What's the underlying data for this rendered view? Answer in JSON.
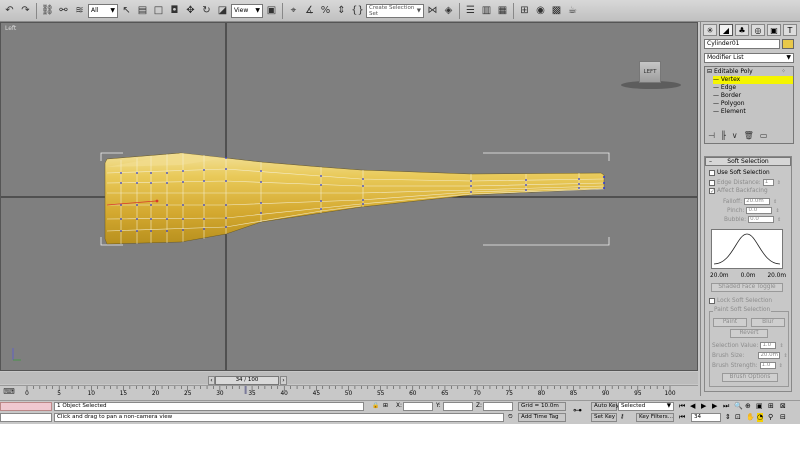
{
  "toolbar": {
    "selection_filter": "All",
    "ref_coord": "View",
    "named_selection": "Create Selection Set",
    "icons": [
      "undo-icon",
      "redo-icon",
      "select-link-icon",
      "unlink-icon",
      "bind-space-warp-icon",
      "selection-filter-icon",
      "select-object-icon",
      "select-by-name-icon",
      "rect-region-icon",
      "window-crossing-icon",
      "move-icon",
      "rotate-icon",
      "scale-icon",
      "pivot-icon",
      "snap-icon",
      "angle-snap-icon",
      "percent-snap-icon",
      "spinner-snap-icon",
      "edit-named-sets-icon",
      "mirror-icon",
      "align-icon",
      "layer-manager-icon",
      "graphite-ribbon-icon",
      "curve-editor-icon",
      "schematic-view-icon",
      "material-editor-icon",
      "render-setup-icon",
      "render-frame-icon",
      "render-icon"
    ]
  },
  "viewport": {
    "label": "Left",
    "viewcube_label": "LEFT"
  },
  "command_panel": {
    "object_name": "Cylinder01",
    "object_color": "#e8c84a",
    "modifier_list": "Modifier List",
    "stack": {
      "root": "Editable Poly",
      "items": [
        "Vertex",
        "Edge",
        "Border",
        "Polygon",
        "Element"
      ],
      "selected": "Vertex"
    },
    "soft_selection": {
      "title": "Soft Selection",
      "use_soft_selection": "Use Soft Selection",
      "edge_distance": "Edge Distance:",
      "edge_distance_value": "1",
      "affect_backfacing": "Affect Backfacing",
      "falloff_label": "Falloff:",
      "falloff_value": "20.0m",
      "pinch_label": "Pinch:",
      "pinch_value": "0.0",
      "bubble_label": "Bubble:",
      "bubble_value": "0.0",
      "curve_left": "20.0m",
      "curve_mid": "0.0m",
      "curve_right": "20.0m",
      "shaded_face_toggle": "Shaded Face Toggle",
      "lock_soft_selection": "Lock Soft Selection",
      "paint_group": "Paint Soft Selection",
      "paint": "Paint",
      "blur": "Blur",
      "revert": "Revert",
      "selection_value_label": "Selection Value:",
      "selection_value": "1.0",
      "brush_size_label": "Brush Size:",
      "brush_size": "20.0m",
      "brush_strength_label": "Brush Strength:",
      "brush_strength": "1.0",
      "brush_options": "Brush Options"
    }
  },
  "timeline": {
    "frame_display": "34 / 100",
    "current_frame": 34,
    "total_frames": 100,
    "tick_labels": [
      "0",
      "5",
      "10",
      "15",
      "20",
      "25",
      "30",
      "35",
      "40",
      "45",
      "50",
      "55",
      "60",
      "65",
      "70",
      "75",
      "80",
      "85",
      "90",
      "95",
      "100"
    ]
  },
  "status": {
    "selection_count": "1 Object Selected",
    "prompt": "Click and drag to pan a non-camera view",
    "x_label": "X:",
    "y_label": "Y:",
    "z_label": "Z:",
    "grid": "Grid = 10.0m",
    "add_time_tag": "Add Time Tag",
    "auto_key": "Auto Key",
    "key_mode": "Selected",
    "set_key": "Set Key",
    "key_filters": "Key Filters...",
    "frame_field": "34"
  }
}
